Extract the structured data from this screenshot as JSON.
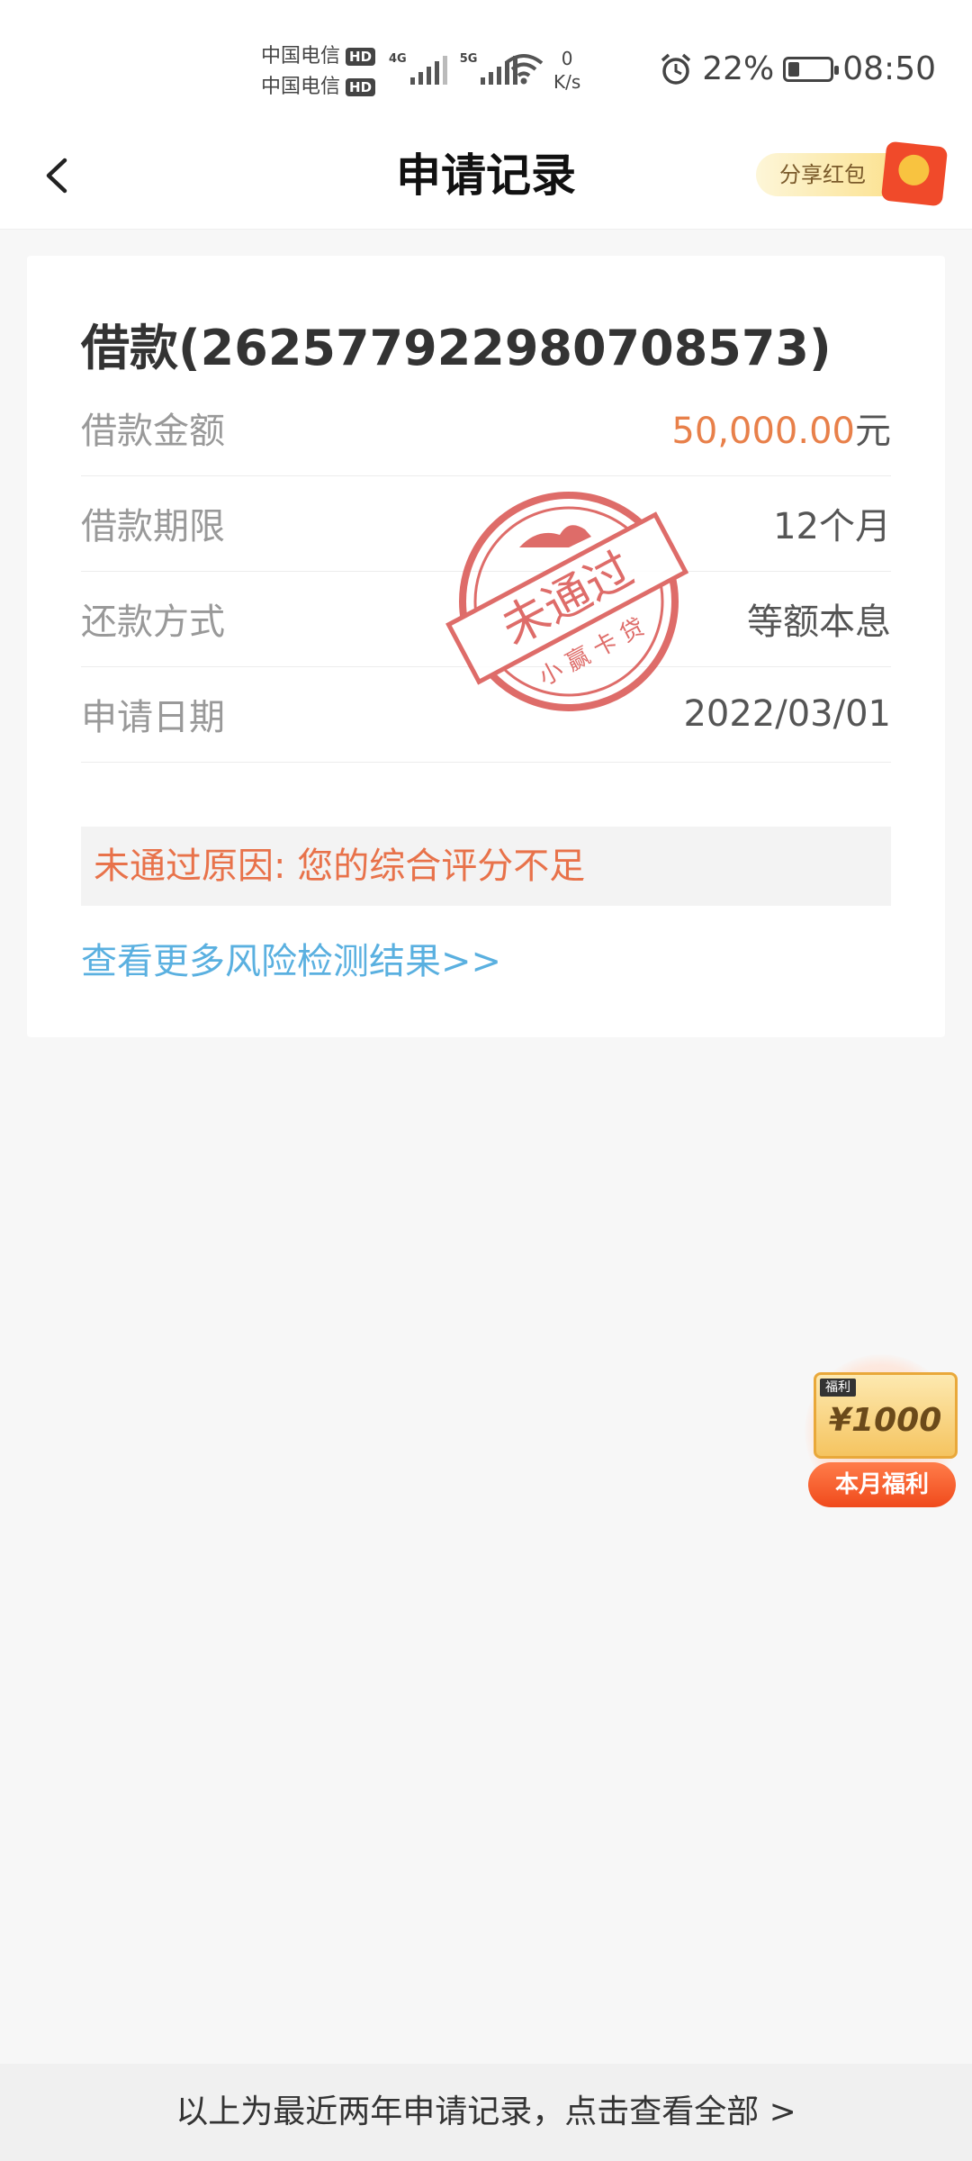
{
  "status_bar": {
    "carrier_1": "中国电信",
    "carrier_2": "中国电信",
    "hd_badge": "HD",
    "signal_1_tag": "4G",
    "signal_2_tag": "5G",
    "net_speed_value": "0",
    "net_speed_unit": "K/s",
    "battery_percent": "22%",
    "time": "08:50"
  },
  "header": {
    "title": "申请记录",
    "share_label": "分享红包"
  },
  "loan": {
    "title": "借款(262577922980708573)",
    "rows": [
      {
        "label": "借款金额",
        "value_number": "50,000.00",
        "value_unit": "元"
      },
      {
        "label": "借款期限",
        "value": "12个月"
      },
      {
        "label": "还款方式",
        "value": "等额本息"
      },
      {
        "label": "申请日期",
        "value": "2022/03/01"
      }
    ],
    "reject_reason": "未通过原因: 您的综合评分不足",
    "more_link": "查看更多风险检测结果>>"
  },
  "stamp": {
    "main_text": "未通过",
    "sub_text": "小赢卡贷",
    "color": "#d9534f"
  },
  "welfare": {
    "tag": "福利",
    "amount": "¥1000",
    "button": "本月福利"
  },
  "footer": {
    "text": "以上为最近两年申请记录，点击查看全部 >"
  },
  "colors": {
    "accent_orange": "#e8804a",
    "link_blue": "#5ab0e0",
    "reason_orange": "#e8724a"
  }
}
